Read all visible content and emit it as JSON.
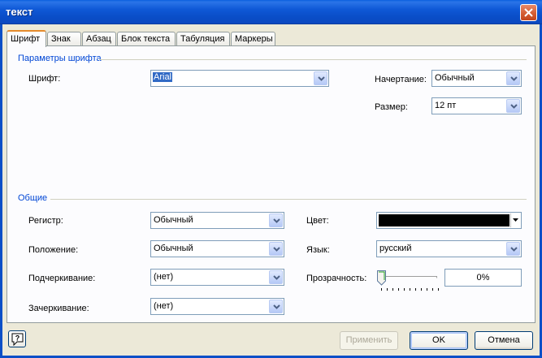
{
  "window": {
    "title": "текст"
  },
  "tabs": [
    {
      "label": "Шрифт",
      "active": true
    },
    {
      "label": "Знак"
    },
    {
      "label": "Абзац"
    },
    {
      "label": "Блок текста"
    },
    {
      "label": "Табуляция"
    },
    {
      "label": "Маркеры"
    }
  ],
  "font_group": {
    "title": "Параметры шрифта",
    "font_label": "Шрифт:",
    "font_value": "Arial",
    "style_label": "Начертание:",
    "style_value": "Обычный",
    "size_label": "Размер:",
    "size_value": "12 пт"
  },
  "general_group": {
    "title": "Общие",
    "case_label": "Регистр:",
    "case_value": "Обычный",
    "position_label": "Положение:",
    "position_value": "Обычный",
    "underline_label": "Подчеркивание:",
    "underline_value": "(нет)",
    "strike_label": "Зачеркивание:",
    "strike_value": "(нет)",
    "color_label": "Цвет:",
    "color_value": "#000000",
    "language_label": "Язык:",
    "language_value": "русский",
    "transparency_label": "Прозрачность:",
    "transparency_value": "0%",
    "transparency_fraction": 0
  },
  "footer": {
    "apply_label": "Применить",
    "ok_label": "OK",
    "cancel_label": "Отмена"
  },
  "icons": [
    "close-icon",
    "chevron-down-icon",
    "help-icon",
    "slider-thumb"
  ]
}
